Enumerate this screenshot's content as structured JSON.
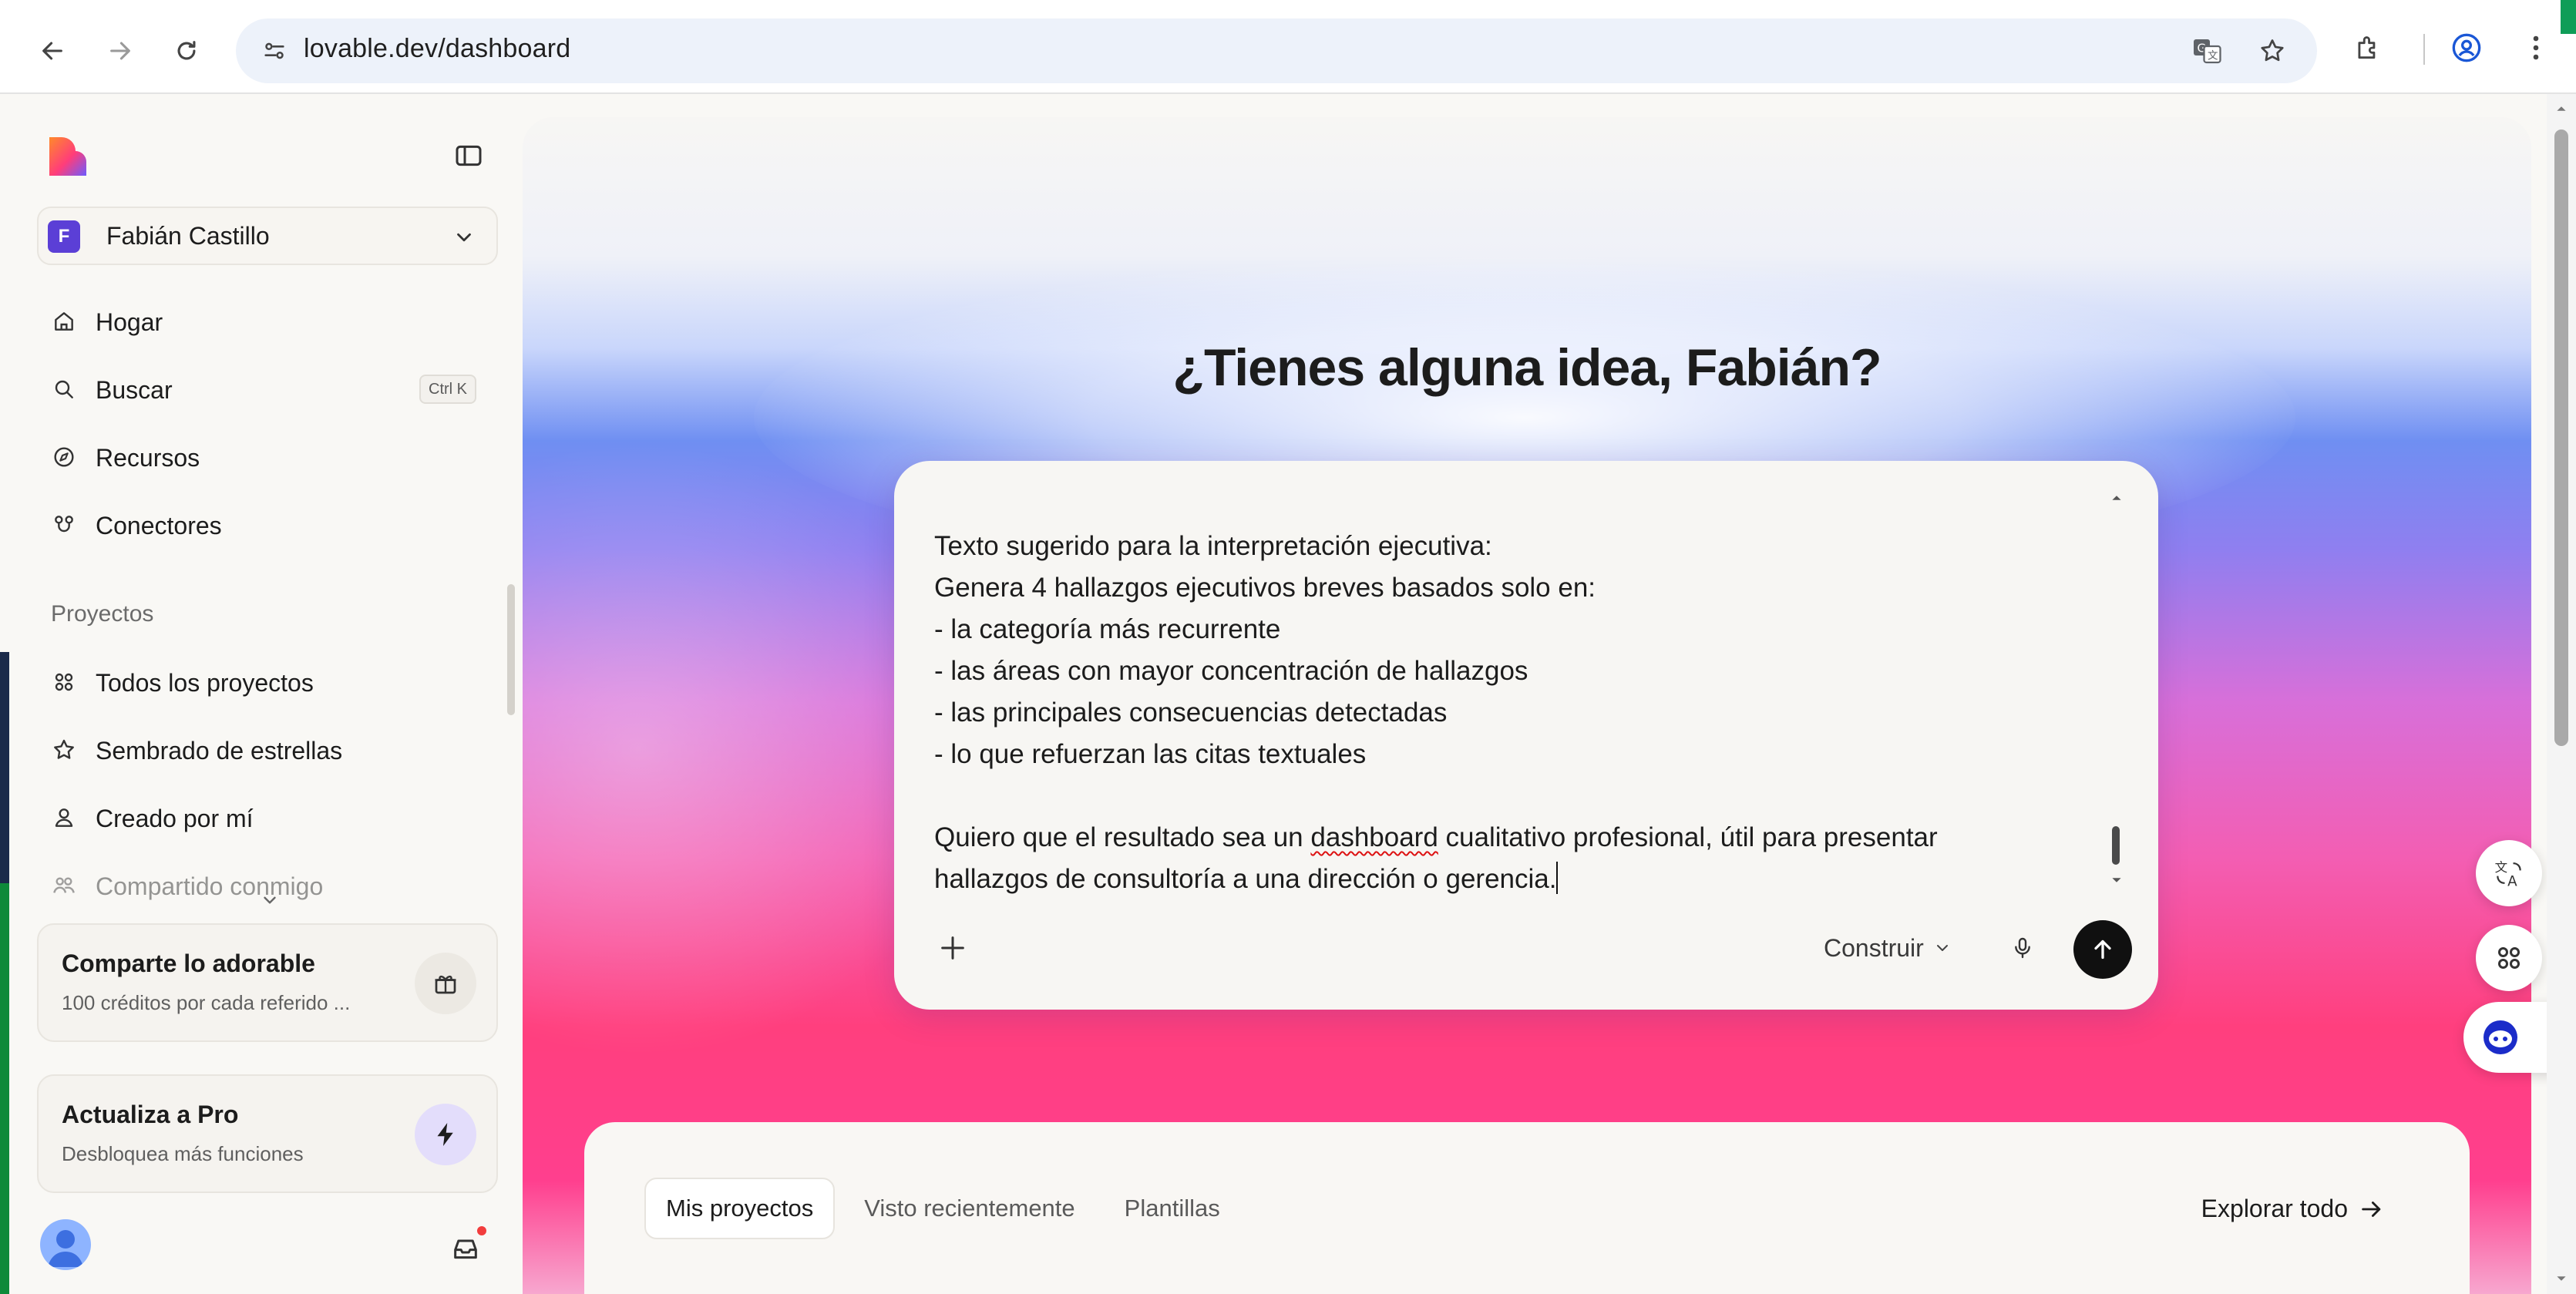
{
  "browser": {
    "url": "lovable.dev/dashboard"
  },
  "sidebar": {
    "workspace": {
      "initial": "F",
      "name": "Fabián Castillo"
    },
    "nav": [
      {
        "label": "Hogar",
        "icon": "home-icon"
      },
      {
        "label": "Buscar",
        "icon": "search-icon",
        "shortcut": "Ctrl K"
      },
      {
        "label": "Recursos",
        "icon": "compass-icon"
      },
      {
        "label": "Conectores",
        "icon": "connectors-icon"
      }
    ],
    "projects_heading": "Proyectos",
    "projects": [
      {
        "label": "Todos los proyectos",
        "icon": "grid-icon"
      },
      {
        "label": "Sembrado de estrellas",
        "icon": "star-icon"
      },
      {
        "label": "Creado por mí",
        "icon": "user-icon"
      },
      {
        "label": "Compartido conmigo",
        "icon": "users-icon"
      }
    ],
    "share_card": {
      "title": "Comparte lo adorable",
      "subtitle": "100 créditos por cada referido ..."
    },
    "upgrade_card": {
      "title": "Actualiza a Pro",
      "subtitle": "Desbloquea más funciones"
    }
  },
  "main": {
    "headline": "¿Tienes alguna idea, Fabián?",
    "composer": {
      "text_before": "Texto sugerido para la interpretación ejecutiva:\nGenera 4 hallazgos ejecutivos breves basados solo en:\n- la categoría más recurrente\n- las áreas con mayor concentración de hallazgos\n- las principales consecuencias detectadas\n- lo que refuerzan las citas textuales\n\nQuiero que el resultado sea un ",
      "text_misspelled": "dashboard",
      "text_after": " cualitativo profesional, útil para presentar\nhallazgos de consultoría a una dirección o gerencia.",
      "mode_label": "Construir"
    },
    "projects_tabs": [
      {
        "label": "Mis proyectos",
        "active": true
      },
      {
        "label": "Visto recientemente",
        "active": false
      },
      {
        "label": "Plantillas",
        "active": false
      }
    ],
    "explore_label": "Explorar todo"
  },
  "colors": {
    "accent_send": "#101010",
    "workspace_avatar": "#5b3fd6",
    "notification_dot": "#f23d3d",
    "gradient_blue": "#6f8ff2",
    "gradient_pink": "#ff3f7e"
  }
}
